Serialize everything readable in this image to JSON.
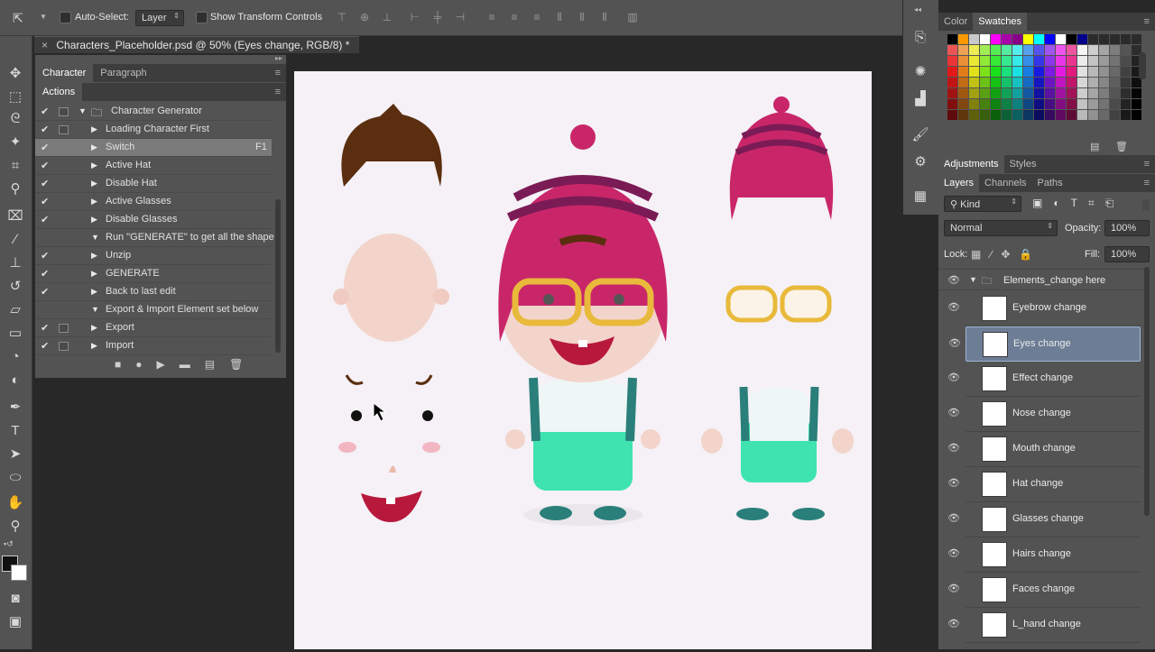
{
  "options_bar": {
    "auto_select_label": "Auto-Select:",
    "auto_select_value": "Layer",
    "show_transform_label": "Show Transform Controls"
  },
  "document_tab": {
    "title": "Characters_Placeholder.psd @ 50% (Eyes change, RGB/8) *"
  },
  "left_panel": {
    "tabs": [
      "Character",
      "Paragraph"
    ],
    "actions_title": "Actions",
    "actions": [
      {
        "label": "Character Generator",
        "checked": true,
        "dialog": true,
        "expanded": true,
        "indent": 0,
        "shortcut": ""
      },
      {
        "label": "Loading Character First",
        "checked": true,
        "dialog": true,
        "expanded": false,
        "indent": 1,
        "shortcut": ""
      },
      {
        "label": "Switch",
        "checked": true,
        "dialog": false,
        "expanded": false,
        "indent": 1,
        "shortcut": "F1",
        "selected": true
      },
      {
        "label": "Active Hat",
        "checked": true,
        "dialog": false,
        "expanded": false,
        "indent": 1,
        "shortcut": ""
      },
      {
        "label": "Disable Hat",
        "checked": true,
        "dialog": false,
        "expanded": false,
        "indent": 1,
        "shortcut": ""
      },
      {
        "label": "Active Glasses",
        "checked": true,
        "dialog": false,
        "expanded": false,
        "indent": 1,
        "shortcut": ""
      },
      {
        "label": "Disable Glasses",
        "checked": true,
        "dialog": false,
        "expanded": false,
        "indent": 1,
        "shortcut": ""
      },
      {
        "label": "Run \"GENERATE\" to get all the shape",
        "checked": false,
        "dialog": false,
        "expanded": true,
        "indent": 1,
        "shortcut": ""
      },
      {
        "label": "Unzip",
        "checked": true,
        "dialog": false,
        "expanded": false,
        "indent": 1,
        "shortcut": ""
      },
      {
        "label": "GENERATE",
        "checked": true,
        "dialog": false,
        "expanded": false,
        "indent": 1,
        "shortcut": ""
      },
      {
        "label": "Back to last edit",
        "checked": true,
        "dialog": false,
        "expanded": false,
        "indent": 1,
        "shortcut": ""
      },
      {
        "label": "Export & Import Element set below",
        "checked": false,
        "dialog": false,
        "expanded": true,
        "indent": 1,
        "shortcut": ""
      },
      {
        "label": "Export",
        "checked": true,
        "dialog": true,
        "expanded": false,
        "indent": 1,
        "shortcut": ""
      },
      {
        "label": "Import",
        "checked": true,
        "dialog": true,
        "expanded": false,
        "indent": 1,
        "shortcut": ""
      }
    ]
  },
  "right_panel": {
    "color_tabs": [
      "Color",
      "Swatches"
    ],
    "adjust_tabs": [
      "Adjustments",
      "Styles"
    ],
    "layer_tabs": [
      "Layers",
      "Channels",
      "Paths"
    ],
    "filter_kind": "Kind",
    "blend_mode": "Normal",
    "opacity_label": "Opacity:",
    "opacity_value": "100%",
    "lock_label": "Lock:",
    "fill_label": "Fill:",
    "fill_value": "100%",
    "group_name": "Elements_change here",
    "layers": [
      {
        "name": "Eyebrow change",
        "selected": false
      },
      {
        "name": "Eyes change",
        "selected": true
      },
      {
        "name": "Effect change",
        "selected": false
      },
      {
        "name": "Nose change",
        "selected": false
      },
      {
        "name": "Mouth change",
        "selected": false
      },
      {
        "name": "Hat change",
        "selected": false
      },
      {
        "name": "Glasses change",
        "selected": false
      },
      {
        "name": "Hairs change",
        "selected": false
      },
      {
        "name": "Faces change",
        "selected": false
      },
      {
        "name": "L_hand change",
        "selected": false
      }
    ]
  },
  "colors": {
    "hat": "#c9266a",
    "hat_stripe": "#7b1b55",
    "hair": "#5a2e0f",
    "skin": "#f3d4cb",
    "glasses": "#e8b93a",
    "shirt": "#eef7f5",
    "overalls": "#3fe3b0",
    "straps": "#2a7f7a"
  }
}
